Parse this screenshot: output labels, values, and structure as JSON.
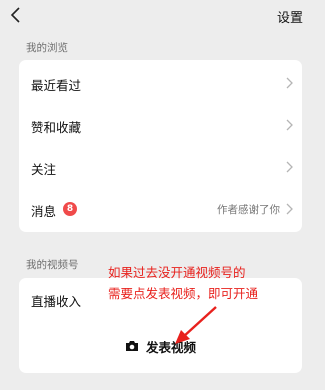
{
  "header": {
    "settings_label": "设置"
  },
  "browse_section": {
    "title": "我的浏览",
    "items": [
      {
        "label": "最近看过"
      },
      {
        "label": "赞和收藏"
      },
      {
        "label": "关注"
      },
      {
        "label": "消息",
        "badge": "8",
        "extra": "作者感谢了你"
      }
    ]
  },
  "channels_section": {
    "title": "我的视频号",
    "live_income_label": "直播收入",
    "post_video_label": "发表视频"
  },
  "annotation": {
    "line1": "如果过去没开通视频号的",
    "line2": "需要点发表视频，即可开通",
    "color": "#e8211d"
  },
  "icons": {
    "back": "chevron-left-icon",
    "row": "chevron-right-icon",
    "post": "camera-icon"
  }
}
